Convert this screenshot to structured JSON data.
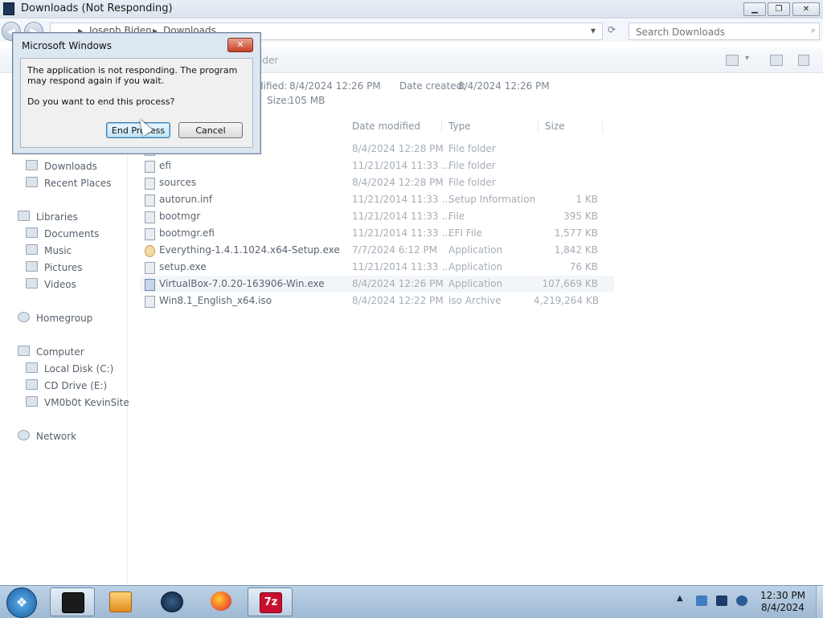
{
  "window": {
    "title": "Downloads (Not Responding)",
    "min_glyph": "▁",
    "max_glyph": "❐",
    "close_glyph": "✕"
  },
  "address": {
    "crumbs": [
      "Joseph Biden",
      "Downloads"
    ],
    "separator": "▸",
    "search_placeholder": "Search Downloads"
  },
  "toolbar": {
    "new_folder_label": "lder"
  },
  "details": {
    "modified_label": "dified:",
    "modified_value": "8/4/2024 12:26 PM",
    "created_label": "Date created:",
    "created_value": "8/4/2024 12:26 PM",
    "size_label": "Size:",
    "size_value": "105 MB"
  },
  "nav": {
    "favorites": [
      "Downloads",
      "Recent Places"
    ],
    "libraries": {
      "label": "Libraries",
      "items": [
        "Documents",
        "Music",
        "Pictures",
        "Videos"
      ]
    },
    "homegroup": "Homegroup",
    "computer": {
      "label": "Computer",
      "items": [
        "Local Disk (C:)",
        "CD Drive (E:)",
        "VM0b0t KevinSite"
      ]
    },
    "network": "Network"
  },
  "columns": {
    "date": "Date modified",
    "type": "Type",
    "size": "Size"
  },
  "files": [
    {
      "name": "",
      "date": "8/4/2024 12:28 PM",
      "type": "File folder",
      "size": ""
    },
    {
      "name": "efi",
      "date": "11/21/2014 11:33 ...",
      "type": "File folder",
      "size": ""
    },
    {
      "name": "sources",
      "date": "8/4/2024 12:28 PM",
      "type": "File folder",
      "size": ""
    },
    {
      "name": "autorun.inf",
      "date": "11/21/2014 11:33 ...",
      "type": "Setup Information",
      "size": "1 KB"
    },
    {
      "name": "bootmgr",
      "date": "11/21/2014 11:33 ...",
      "type": "File",
      "size": "395 KB"
    },
    {
      "name": "bootmgr.efi",
      "date": "11/21/2014 11:33 ...",
      "type": "EFI File",
      "size": "1,577 KB"
    },
    {
      "name": "Everything-1.4.1.1024.x64-Setup.exe",
      "date": "7/7/2024 6:12 PM",
      "type": "Application",
      "size": "1,842 KB"
    },
    {
      "name": "setup.exe",
      "date": "11/21/2014 11:33 ...",
      "type": "Application",
      "size": "76 KB"
    },
    {
      "name": "VirtualBox-7.0.20-163906-Win.exe",
      "date": "8/4/2024 12:26 PM",
      "type": "Application",
      "size": "107,669 KB"
    },
    {
      "name": "Win8.1_English_x64.iso",
      "date": "8/4/2024 12:22 PM",
      "type": "iso Archive",
      "size": "4,219,264 KB"
    }
  ],
  "dialog": {
    "title": "Microsoft Windows",
    "close_glyph": "✕",
    "message": "The application is not responding. The program may respond again if you wait.",
    "question": "Do you want to end this process?",
    "end_label": "End Process",
    "cancel_label": "Cancel"
  },
  "taskbar": {
    "start_glyph": "❖",
    "z_label": "7z",
    "tray_arrow": "▲",
    "time": "12:30 PM",
    "date": "8/4/2024"
  }
}
